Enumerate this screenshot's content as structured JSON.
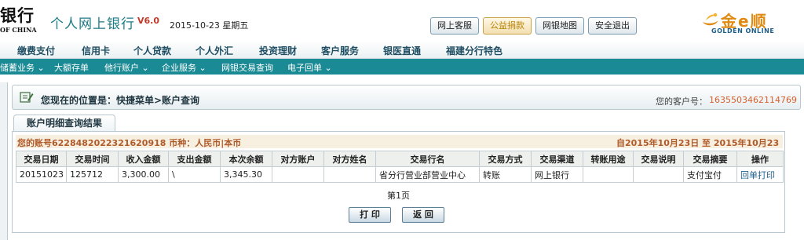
{
  "header": {
    "bank_name": "银行",
    "bank_name_en": "OF CHINA",
    "app_title": "个人网上银行",
    "version": "V6.0",
    "date": "2015-10-23 星期五",
    "buttons": [
      {
        "label": "网上客服",
        "highlight": false
      },
      {
        "label": "公益捐款",
        "highlight": true
      },
      {
        "label": "网银地图",
        "highlight": false
      },
      {
        "label": "安全退出",
        "highlight": false
      }
    ],
    "golden_online": {
      "cn": "金e顺",
      "en": "GOLDEN ONLINE"
    }
  },
  "main_nav": [
    "缴费支付",
    "信用卡",
    "个人贷款",
    "个人外汇",
    "投资理财",
    "客户服务",
    "银医直通",
    "福建分行特色"
  ],
  "sub_nav": [
    "储蓄业务 ⌄",
    "大额存单",
    "他行账户 ⌄",
    "企业服务 ⌄",
    "网银交易查询",
    "电子回单 ⌄"
  ],
  "location": {
    "text": "您现在的位置是：快捷菜单>账户查询",
    "customer_label": "您的客户号：",
    "customer_no": "1635503462114769"
  },
  "result": {
    "tab_label": "账户明细查询结果",
    "account_info": "您的账号6228482022321620918 币种：人民币|本币",
    "date_range": "自2015年10月23日 至 2015年10月23日",
    "columns": [
      "交易日期",
      "交易时间",
      "收入金额",
      "支出金额",
      "本次余额",
      "对方账户",
      "对方姓名",
      "交易行名",
      "交易方式",
      "交易渠道",
      "转账用途",
      "交易说明",
      "交易摘要",
      "操作"
    ],
    "rows": [
      [
        "20151023",
        "125712",
        "3,300.00",
        "\\",
        "3,345.30",
        "",
        "",
        "省分行营业部营业中心",
        "转账",
        "网上银行",
        "",
        "",
        "支付宝付",
        "回单打印"
      ]
    ],
    "page_info": "第1页",
    "print_label": "打 印",
    "back_label": "返 回"
  },
  "colors": {
    "teal": "#1a8a94",
    "accent_orange": "#d6602d",
    "account_brown": "#b05a2a",
    "link_blue": "#1d5f8a",
    "golden": "#e08a12"
  },
  "icons": [
    "location-edit-icon",
    "golden-online-logo-icon",
    "dropdown-caret-icon"
  ]
}
